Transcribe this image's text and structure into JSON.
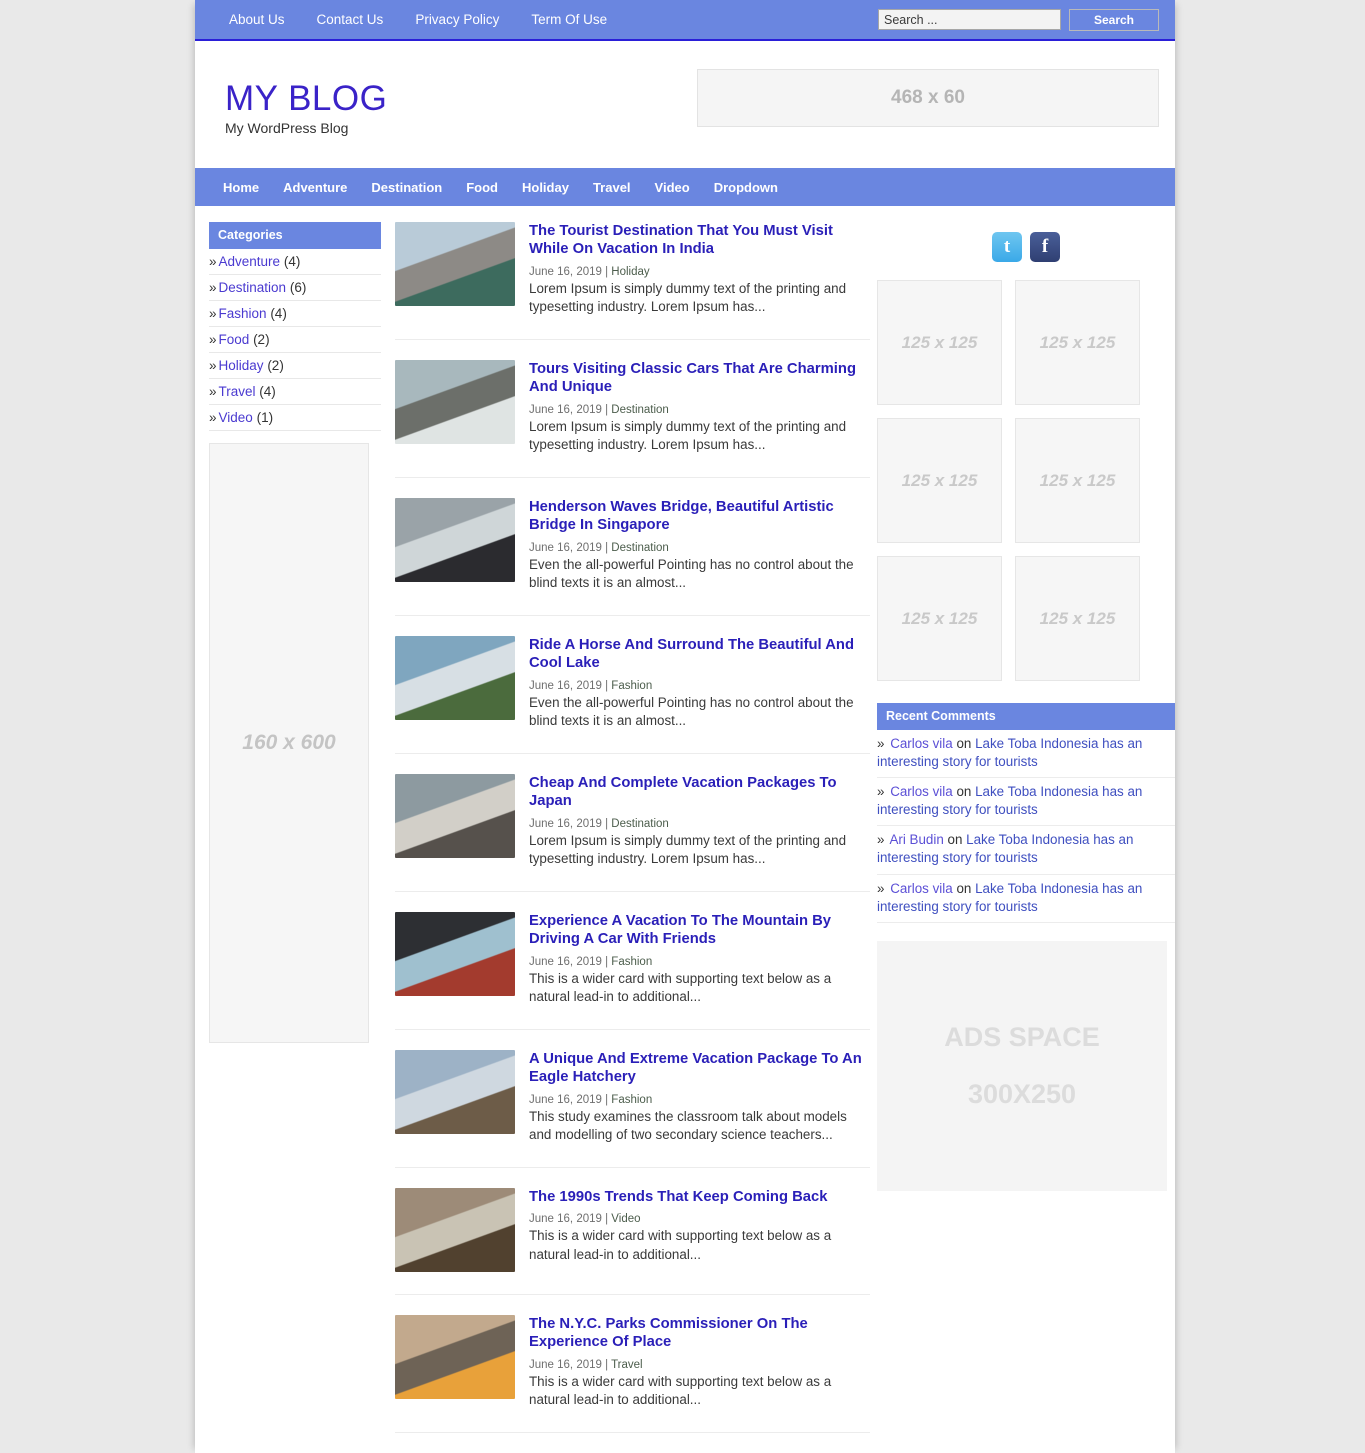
{
  "topbar": {
    "links": [
      "About Us",
      "Contact Us",
      "Privacy Policy",
      "Term Of Use"
    ],
    "search_placeholder": "Search ...",
    "search_value": "",
    "search_button": "Search"
  },
  "masthead": {
    "title": "MY BLOG",
    "tagline": "My WordPress Blog",
    "leaderboard_label": "468 x 60"
  },
  "mainnav": {
    "items": [
      "Home",
      "Adventure",
      "Destination",
      "Food",
      "Holiday",
      "Travel",
      "Video",
      "Dropdown"
    ]
  },
  "sidebar_left": {
    "categories_title": "Categories",
    "categories": [
      {
        "name": "Adventure",
        "count": "(4)"
      },
      {
        "name": "Destination",
        "count": "(6)"
      },
      {
        "name": "Fashion",
        "count": "(4)"
      },
      {
        "name": "Food",
        "count": "(2)"
      },
      {
        "name": "Holiday",
        "count": "(2)"
      },
      {
        "name": "Travel",
        "count": "(4)"
      },
      {
        "name": "Video",
        "count": "(1)"
      }
    ],
    "skyscraper_label": "160 x 600"
  },
  "posts": [
    {
      "title": "The Tourist Destination That You Must Visit While On Vacation In India",
      "date": "June 16, 2019",
      "category": "Holiday",
      "excerpt": "Lorem Ipsum is simply dummy text of the printing and typesetting industry. Lorem Ipsum has..."
    },
    {
      "title": "Tours Visiting Classic Cars That Are Charming And Unique",
      "date": "June 16, 2019",
      "category": "Destination",
      "excerpt": "Lorem Ipsum is simply dummy text of the printing and typesetting industry. Lorem Ipsum has..."
    },
    {
      "title": "Henderson Waves Bridge, Beautiful Artistic Bridge In Singapore",
      "date": "June 16, 2019",
      "category": "Destination",
      "excerpt": "Even the all-powerful Pointing has no control about the blind texts it is an almost..."
    },
    {
      "title": "Ride A Horse And Surround The Beautiful And Cool Lake",
      "date": "June 16, 2019",
      "category": "Fashion",
      "excerpt": "Even the all-powerful Pointing has no control about the blind texts it is an almost..."
    },
    {
      "title": "Cheap And Complete Vacation Packages To Japan",
      "date": "June 16, 2019",
      "category": "Destination",
      "excerpt": "Lorem Ipsum is simply dummy text of the printing and typesetting industry. Lorem Ipsum has..."
    },
    {
      "title": "Experience A Vacation To The Mountain By Driving A Car With Friends",
      "date": "June 16, 2019",
      "category": "Fashion",
      "excerpt": "This is a wider card with supporting text below as a natural lead-in to additional..."
    },
    {
      "title": "A Unique And Extreme Vacation Package To An Eagle Hatchery",
      "date": "June 16, 2019",
      "category": "Fashion",
      "excerpt": "This study examines the classroom talk about models and modelling of two secondary science teachers..."
    },
    {
      "title": "The 1990s Trends That Keep Coming Back",
      "date": "June 16, 2019",
      "category": "Video",
      "excerpt": "This is a wider card with supporting text below as a natural lead-in to additional..."
    },
    {
      "title": "The N.Y.C. Parks Commissioner On The Experience Of Place",
      "date": "June 16, 2019",
      "category": "Travel",
      "excerpt": "This is a wider card with supporting text below as a natural lead-in to additional..."
    }
  ],
  "sidebar_right": {
    "social": [
      {
        "name": "twitter",
        "glyph": "t"
      },
      {
        "name": "facebook",
        "glyph": "f"
      }
    ],
    "ad_boxes": [
      "125 x 125",
      "125 x 125",
      "125 x 125",
      "125 x 125",
      "125 x 125",
      "125 x 125"
    ],
    "comments_title": "Recent Comments",
    "comments": [
      {
        "author": "Carlos vila",
        "on": "on",
        "post": "Lake Toba Indonesia has an interesting story for tourists"
      },
      {
        "author": "Carlos vila",
        "on": "on",
        "post": "Lake Toba Indonesia has an interesting story for tourists"
      },
      {
        "author": "Ari Budin",
        "on": "on",
        "post": "Lake Toba Indonesia has an interesting story for tourists"
      },
      {
        "author": "Carlos vila",
        "on": "on",
        "post": "Lake Toba Indonesia has an interesting story for tourists"
      }
    ],
    "ads_space_line1": "ADS SPACE",
    "ads_space_line2": "300X250"
  },
  "colors": {
    "nav_blue": "#6a86e0",
    "link_blue": "#2a1fb8",
    "brand_purple": "#3a23c8",
    "page_bg": "#e9e9e9"
  }
}
